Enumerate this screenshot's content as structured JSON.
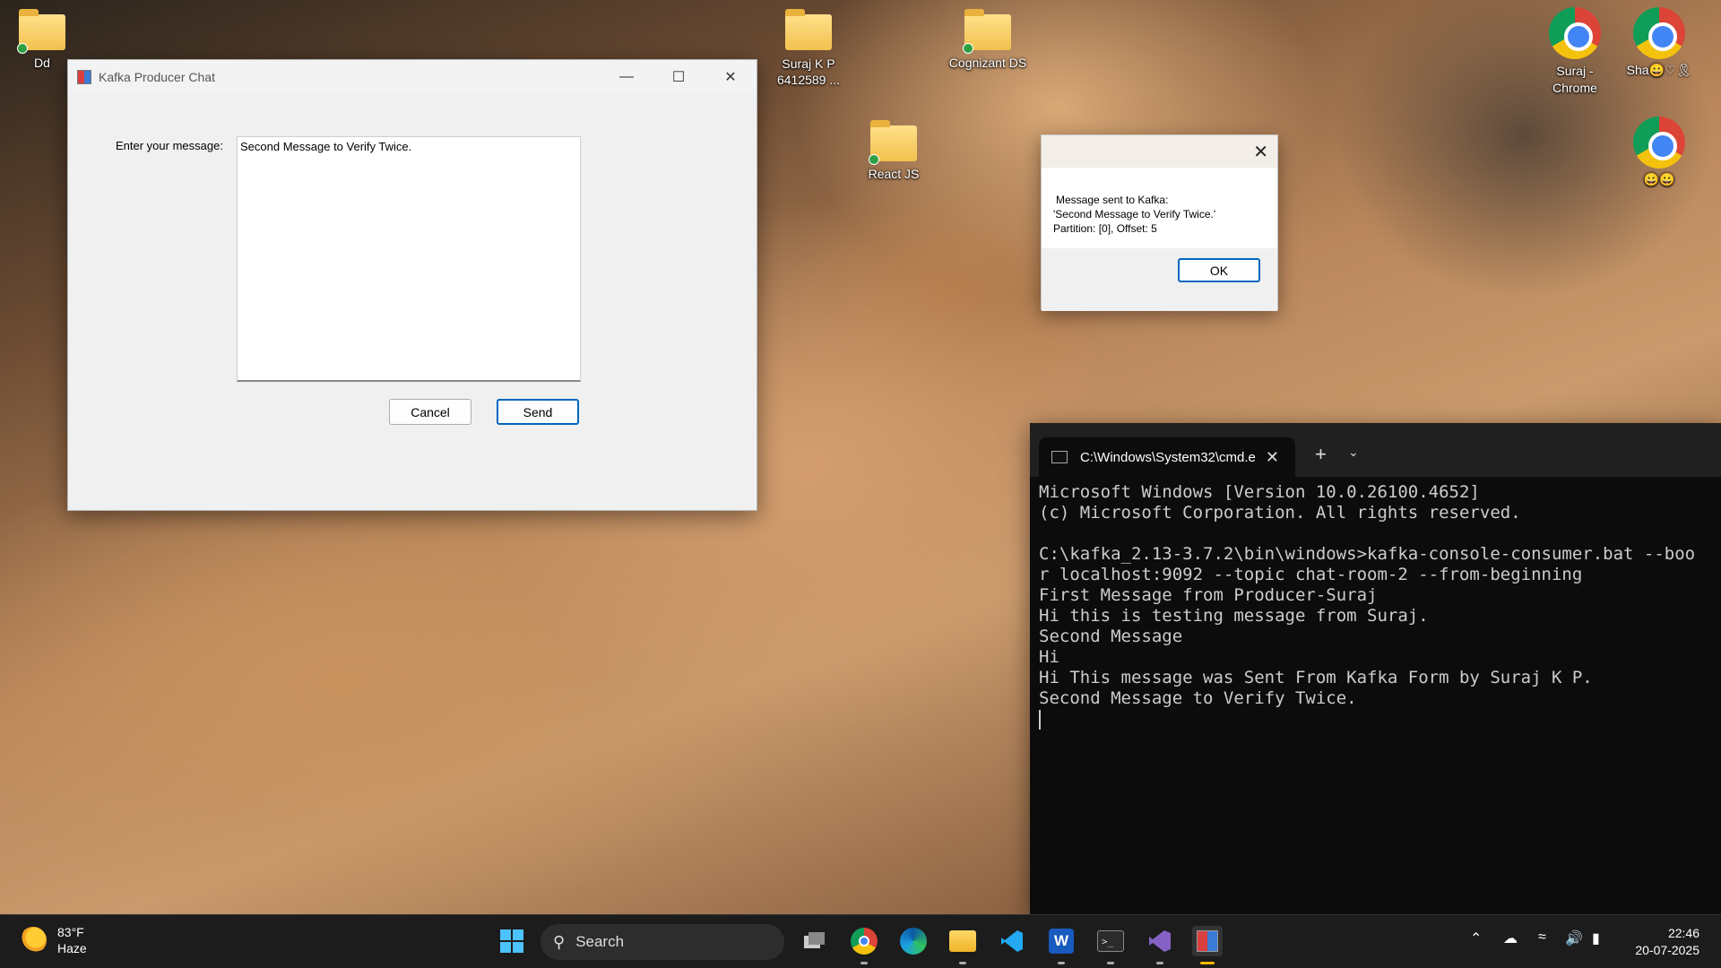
{
  "desktop": {
    "icons": [
      {
        "label": "Dd"
      },
      {
        "label": "Suraj K P 6412589 ..."
      },
      {
        "label": "Cognizant DS"
      },
      {
        "label": "React JS"
      },
      {
        "label": "Suraj - Chrome"
      },
      {
        "label": "Sha😀♡🎗"
      },
      {
        "label": "😀😀"
      }
    ]
  },
  "kafka_window": {
    "title": "Kafka Producer Chat",
    "minimize_icon": "—",
    "maximize_icon": "☐",
    "close_icon": "✕",
    "message_label": "Enter your message:",
    "message_value": "Second Message to Verify Twice.",
    "cancel_label": "Cancel",
    "send_label": "Send"
  },
  "dialog": {
    "close_icon": "✕",
    "line1": "Message sent to Kafka:",
    "line2": "'Second Message to Verify Twice.'",
    "line3": "Partition: [0], Offset: 5",
    "ok_label": "OK"
  },
  "terminal": {
    "tab_title": "C:\\Windows\\System32\\cmd.e",
    "close_icon": "✕",
    "new_tab_icon": "+",
    "dropdown_icon": "⌄",
    "lines": [
      "Microsoft Windows [Version 10.0.26100.4652]",
      "(c) Microsoft Corporation. All rights reserved.",
      "",
      "C:\\kafka_2.13-3.7.2\\bin\\windows>kafka-console-consumer.bat --boo",
      "r localhost:9092 --topic chat-room-2 --from-beginning",
      "First Message from Producer-Suraj",
      "Hi this is testing message from Suraj.",
      "Second Message",
      "Hi",
      "Hi This message was Sent From Kafka Form by Suraj K P.",
      "Second Message to Verify Twice."
    ]
  },
  "taskbar": {
    "weather_temp": "83°F",
    "weather_desc": "Haze",
    "search_placeholder": "Search",
    "time": "22:46",
    "date": "20-07-2025",
    "icons": [
      "start-icon",
      "task-view-icon",
      "chrome-icon",
      "edge-icon",
      "file-explorer-icon",
      "vscode-icon",
      "word-icon",
      "terminal-icon",
      "visual-studio-icon",
      "kafka-app-icon"
    ],
    "tray_icons": [
      "chevron-up-icon",
      "onedrive-icon",
      "wifi-icon",
      "volume-icon",
      "battery-icon"
    ]
  }
}
